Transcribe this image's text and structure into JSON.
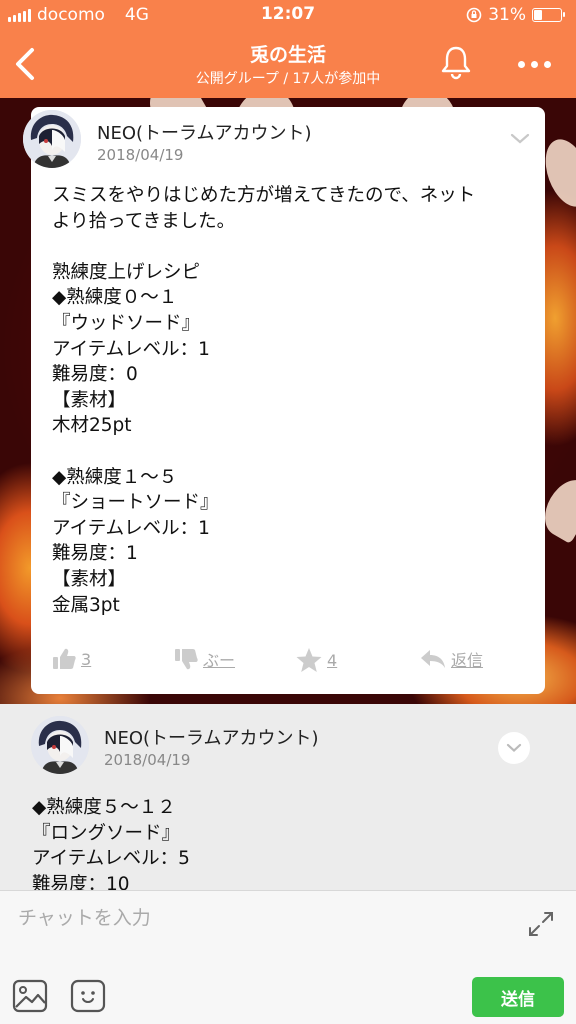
{
  "status_bar": {
    "carrier": "docomo",
    "network": "4G",
    "time": "12:07",
    "battery_percent": "31%",
    "battery_level": 0.31
  },
  "nav": {
    "title": "兎の生活",
    "subtitle": "公開グループ / 17人が参加中",
    "back_icon": "chevron-left-icon",
    "bell_icon": "bell-icon",
    "more_icon": "more-dots-icon"
  },
  "posts": [
    {
      "author": "NEO(トーラムアカウント)",
      "date": "2018/04/19",
      "body": "スミスをやりはじめた方が増えてきたので、ネット\nより拾ってきました。\n\n熟練度上げレシピ\n◆熟練度０～１\n『ウッドソード』\nアイテムレベル：1\n難易度：0\n【素材】\n木材25pt\n\n◆熟練度１～５\n『ショートソード』\nアイテムレベル：1\n難易度：1\n【素材】\n金属3pt",
      "actions": {
        "like_count": "3",
        "boo_label": "ぶー",
        "star_count": "4",
        "reply_label": "返信"
      }
    },
    {
      "author": "NEO(トーラムアカウント)",
      "date": "2018/04/19",
      "body": "◆熟練度５～１２\n『ロングソード』\nアイテムレベル：5\n難易度：10"
    }
  ],
  "composer": {
    "placeholder": "チャットを入力",
    "send_label": "送信"
  },
  "colors": {
    "header": "#f9814b",
    "send": "#3cc24a"
  }
}
